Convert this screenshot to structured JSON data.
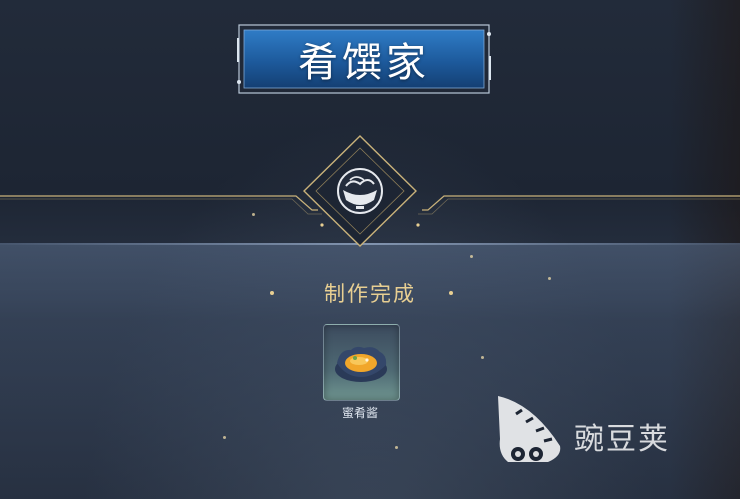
{
  "title": "肴馔家",
  "result": {
    "status_text": "制作完成",
    "item": {
      "name": "蜜肴酱",
      "icon": "honey-sauce-dish-icon"
    }
  },
  "emblem": {
    "icon": "cooking-pot-icon"
  },
  "watermark": {
    "text": "豌豆荚",
    "logo": "wandoujia-logo"
  },
  "colors": {
    "gold_accent": "#e8cf92",
    "plaque_blue": "#1d5a9c",
    "background": "#1d2533"
  }
}
